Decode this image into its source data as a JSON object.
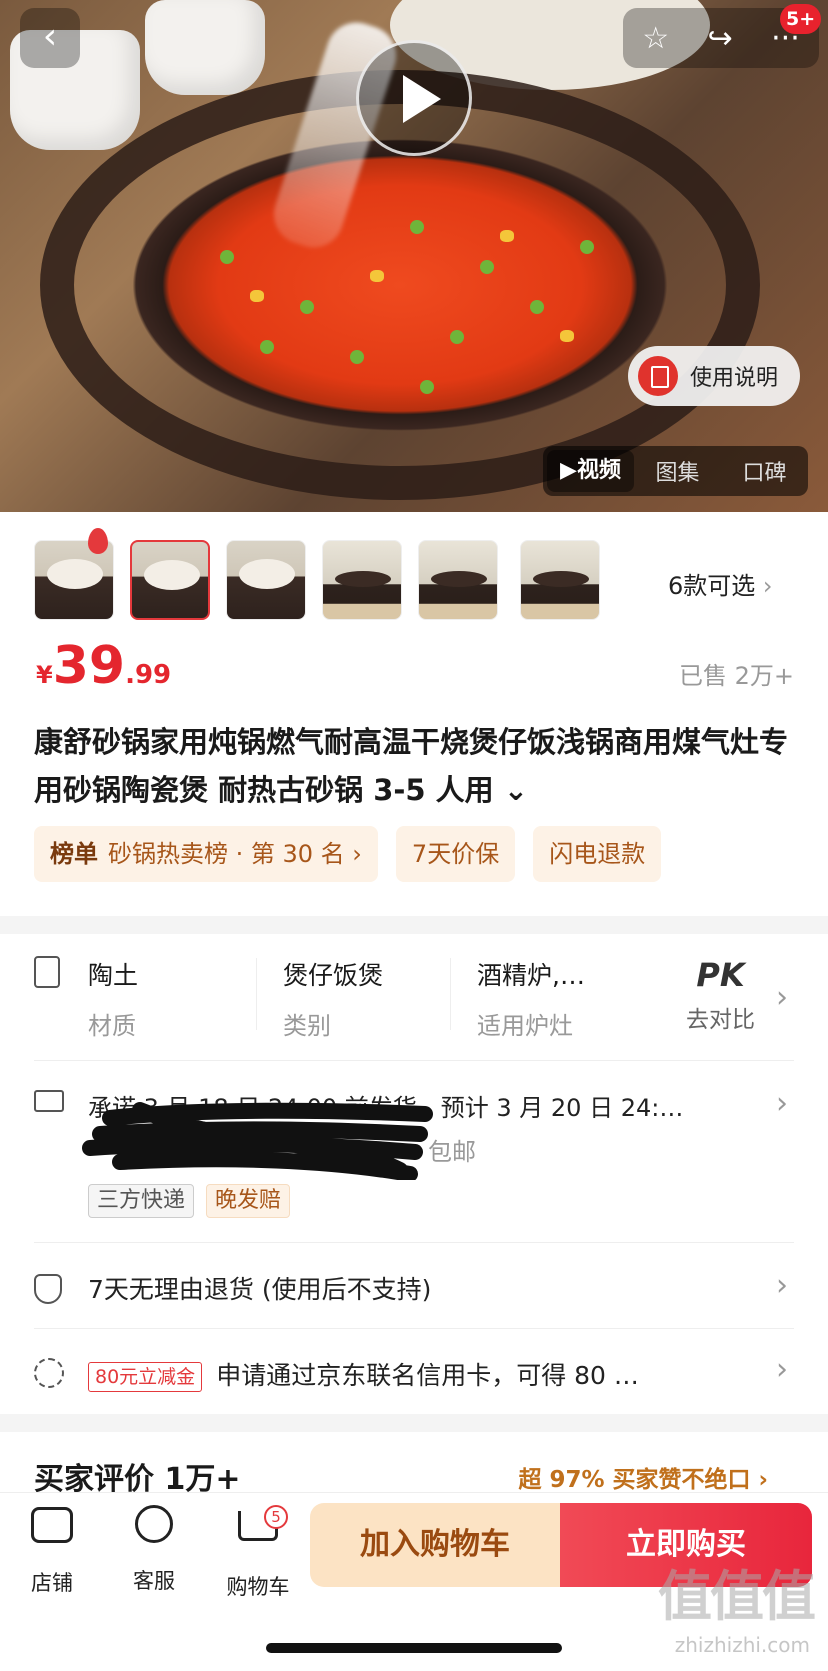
{
  "header": {
    "back_icon": "‹",
    "star_icon": "☆",
    "share_icon": "↪",
    "more_icon": "···",
    "notif_badge": "5+"
  },
  "media": {
    "guide_label": "使用说明",
    "tabs": [
      "▶视频",
      "图集",
      "口碑"
    ]
  },
  "variants_label": "6款可选",
  "price": {
    "currency": "¥",
    "integer": "39",
    "decimal": ".99",
    "sold": "已售 2万+"
  },
  "title": "康舒砂锅家用炖锅燃气耐高温干烧煲仔饭浅锅商用煤气灶专用砂锅陶瓷煲 耐热古砂锅 3-5 人用",
  "expand_icon": "⌄",
  "chips": {
    "rank_label": "榜单",
    "rank_text": "砂锅热卖榜 · 第 30 名 ›",
    "price_guard": "7天价保",
    "fast_refund": "闪电退款"
  },
  "spec": {
    "items": [
      {
        "value": "陶土",
        "key": "材质"
      },
      {
        "value": "煲仔饭煲",
        "key": "类别"
      },
      {
        "value": "酒精炉,…",
        "key": "适用炉灶"
      }
    ],
    "pk": "PK",
    "pk_label": "去对比"
  },
  "shipping": {
    "promise": "承诺 3 月 18 日 24:00 前发货，预计 3 月 20 日 24:…",
    "free": "包邮",
    "tags": [
      "三方快递",
      "晚发赔"
    ]
  },
  "returns": {
    "text": "7天无理由退货 (使用后不支持)"
  },
  "promo": {
    "tag": "80元立减金",
    "text": "申请通过京东联名信用卡，可得 80 …"
  },
  "reviews": {
    "title": "买家评价 1万+",
    "praise": "超 97% 买家赞不绝口 ›"
  },
  "bottom": {
    "store": "店铺",
    "service": "客服",
    "cart": "购物车",
    "cart_count": "5",
    "add_to_cart": "加入购物车",
    "buy_now": "立即购买"
  },
  "watermark": {
    "logo": "值值值",
    "url": "zhizhizhi.com"
  },
  "colors": {
    "accent": "#e4393c",
    "rank_text": "#a7561a"
  }
}
